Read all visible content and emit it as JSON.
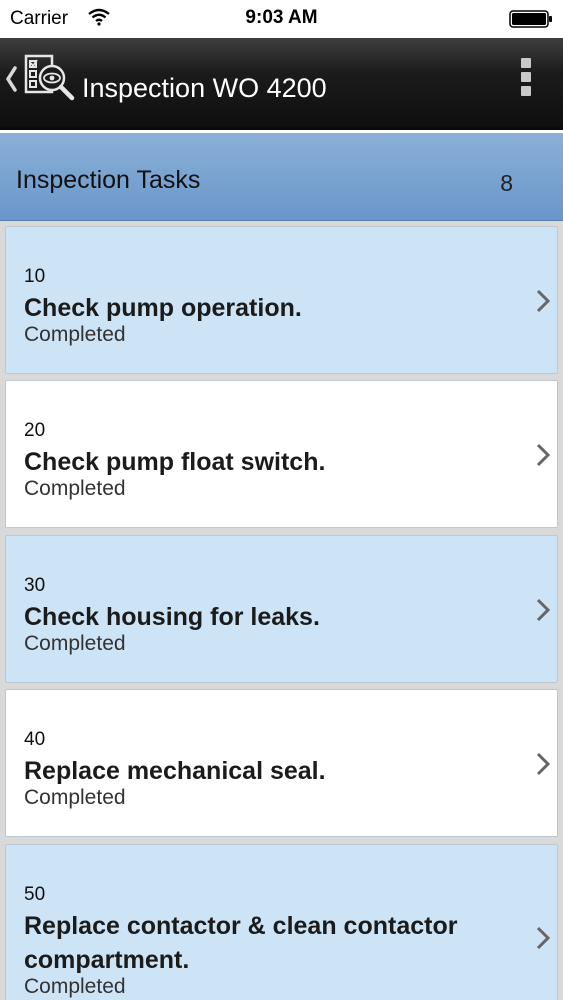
{
  "status_bar": {
    "carrier": "Carrier",
    "time": "9:03 AM"
  },
  "header": {
    "title": "Inspection WO 4200",
    "icons": [
      "back-chevron-icon",
      "inspection-icon",
      "more-vert-icon"
    ]
  },
  "section": {
    "title": "Inspection Tasks",
    "count": "8"
  },
  "colors": {
    "header_bg": "#1b1b1b",
    "section_bg": "#7aa3d0",
    "row_shaded": "#cde3f6",
    "row_plain": "#ffffff"
  },
  "tasks": [
    {
      "seq": "10",
      "description": "Check pump operation.",
      "status": "Completed"
    },
    {
      "seq": "20",
      "description": "Check pump float switch.",
      "status": "Completed"
    },
    {
      "seq": "30",
      "description": "Check housing for leaks.",
      "status": "Completed"
    },
    {
      "seq": "40",
      "description": "Replace mechanical seal.",
      "status": "Completed"
    },
    {
      "seq": "50",
      "description": "Replace contactor & clean contactor compartment.",
      "status": "Completed"
    }
  ]
}
